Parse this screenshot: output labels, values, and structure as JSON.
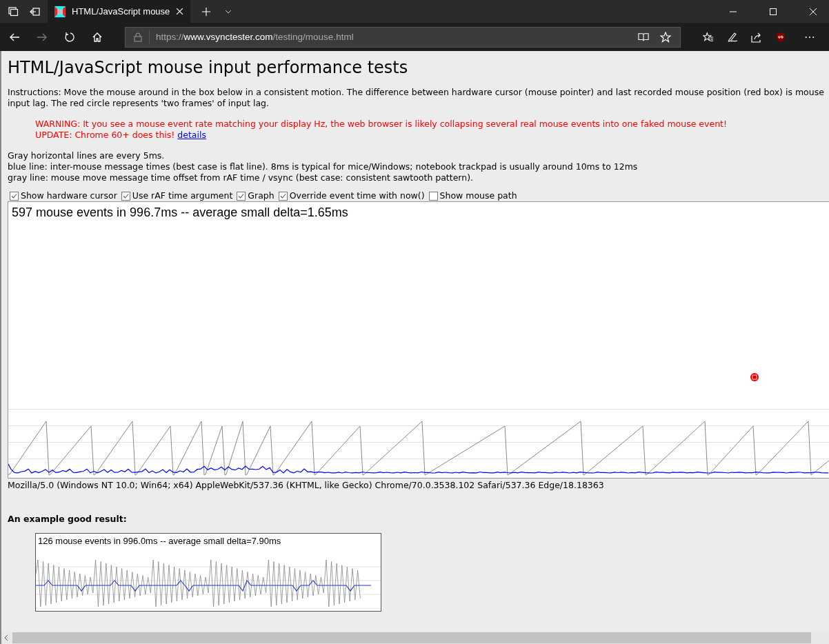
{
  "browser": {
    "tabs": [
      {
        "title": "HTML/JavaScript mouse",
        "selected": true
      }
    ],
    "url": {
      "scheme": "https://",
      "host": "www.vsynctester.com",
      "path": "/testing/mouse.html"
    }
  },
  "page": {
    "title": "HTML/JavaScript mouse input performance tests",
    "instructions": "Instructions: Move the mouse around in the box below in a consistent motion. The difference between hardware cursor (mouse pointer) and last recorded mouse position (red box) is mouse input lag. The red circle represents 'two frames' of input lag.",
    "warnings": [
      {
        "text": "WARNING: It you see a mouse event rate matching your display Hz, the web browser is likely collapsing several real mouse events into one faked mouse event!"
      },
      {
        "text": "UPDATE: Chrome 60+ does this!",
        "link": "details"
      }
    ],
    "notes": [
      "Gray horizontal lines are every 5ms.",
      "blue line: inter-mouse message times (best case is flat line). 8ms is typical for mice/Windows; notebook trackpad is usually around 10ms to 12ms",
      "gray line: mouse move message time offset from rAF time / vsync (best case: consistent sawtooth pattern)."
    ],
    "options": [
      {
        "label": "Show hardware cursor",
        "checked": true
      },
      {
        "label": "Use rAF time argument",
        "checked": true
      },
      {
        "label": "Graph",
        "checked": true
      },
      {
        "label": "Override event time with now()",
        "checked": true
      },
      {
        "label": "Show mouse path",
        "checked": false
      }
    ],
    "test_box": {
      "stats": "597 mouse events in 996.7ms -- average small delta=1.65ms"
    },
    "user_agent": "Mozilla/5.0 (Windows NT 10.0; Win64; x64) AppleWebKit/537.36 (KHTML, like Gecko) Chrome/70.0.3538.102 Safari/537.36 Edge/18.18363",
    "example": {
      "heading": "An example good result:",
      "stats": "126 mouse events in 996.0ms -- average small delta=7.90ms"
    }
  }
}
